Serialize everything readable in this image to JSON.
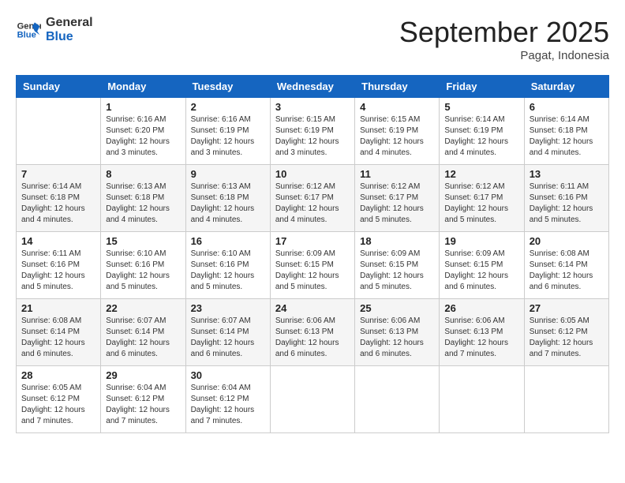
{
  "logo": {
    "line1": "General",
    "line2": "Blue"
  },
  "title": "September 2025",
  "location": "Pagat, Indonesia",
  "headers": [
    "Sunday",
    "Monday",
    "Tuesday",
    "Wednesday",
    "Thursday",
    "Friday",
    "Saturday"
  ],
  "weeks": [
    [
      {
        "day": "",
        "sunrise": "",
        "sunset": "",
        "daylight": ""
      },
      {
        "day": "1",
        "sunrise": "Sunrise: 6:16 AM",
        "sunset": "Sunset: 6:20 PM",
        "daylight": "Daylight: 12 hours and 3 minutes."
      },
      {
        "day": "2",
        "sunrise": "Sunrise: 6:16 AM",
        "sunset": "Sunset: 6:19 PM",
        "daylight": "Daylight: 12 hours and 3 minutes."
      },
      {
        "day": "3",
        "sunrise": "Sunrise: 6:15 AM",
        "sunset": "Sunset: 6:19 PM",
        "daylight": "Daylight: 12 hours and 3 minutes."
      },
      {
        "day": "4",
        "sunrise": "Sunrise: 6:15 AM",
        "sunset": "Sunset: 6:19 PM",
        "daylight": "Daylight: 12 hours and 4 minutes."
      },
      {
        "day": "5",
        "sunrise": "Sunrise: 6:14 AM",
        "sunset": "Sunset: 6:19 PM",
        "daylight": "Daylight: 12 hours and 4 minutes."
      },
      {
        "day": "6",
        "sunrise": "Sunrise: 6:14 AM",
        "sunset": "Sunset: 6:18 PM",
        "daylight": "Daylight: 12 hours and 4 minutes."
      }
    ],
    [
      {
        "day": "7",
        "sunrise": "Sunrise: 6:14 AM",
        "sunset": "Sunset: 6:18 PM",
        "daylight": "Daylight: 12 hours and 4 minutes."
      },
      {
        "day": "8",
        "sunrise": "Sunrise: 6:13 AM",
        "sunset": "Sunset: 6:18 PM",
        "daylight": "Daylight: 12 hours and 4 minutes."
      },
      {
        "day": "9",
        "sunrise": "Sunrise: 6:13 AM",
        "sunset": "Sunset: 6:18 PM",
        "daylight": "Daylight: 12 hours and 4 minutes."
      },
      {
        "day": "10",
        "sunrise": "Sunrise: 6:12 AM",
        "sunset": "Sunset: 6:17 PM",
        "daylight": "Daylight: 12 hours and 4 minutes."
      },
      {
        "day": "11",
        "sunrise": "Sunrise: 6:12 AM",
        "sunset": "Sunset: 6:17 PM",
        "daylight": "Daylight: 12 hours and 5 minutes."
      },
      {
        "day": "12",
        "sunrise": "Sunrise: 6:12 AM",
        "sunset": "Sunset: 6:17 PM",
        "daylight": "Daylight: 12 hours and 5 minutes."
      },
      {
        "day": "13",
        "sunrise": "Sunrise: 6:11 AM",
        "sunset": "Sunset: 6:16 PM",
        "daylight": "Daylight: 12 hours and 5 minutes."
      }
    ],
    [
      {
        "day": "14",
        "sunrise": "Sunrise: 6:11 AM",
        "sunset": "Sunset: 6:16 PM",
        "daylight": "Daylight: 12 hours and 5 minutes."
      },
      {
        "day": "15",
        "sunrise": "Sunrise: 6:10 AM",
        "sunset": "Sunset: 6:16 PM",
        "daylight": "Daylight: 12 hours and 5 minutes."
      },
      {
        "day": "16",
        "sunrise": "Sunrise: 6:10 AM",
        "sunset": "Sunset: 6:16 PM",
        "daylight": "Daylight: 12 hours and 5 minutes."
      },
      {
        "day": "17",
        "sunrise": "Sunrise: 6:09 AM",
        "sunset": "Sunset: 6:15 PM",
        "daylight": "Daylight: 12 hours and 5 minutes."
      },
      {
        "day": "18",
        "sunrise": "Sunrise: 6:09 AM",
        "sunset": "Sunset: 6:15 PM",
        "daylight": "Daylight: 12 hours and 5 minutes."
      },
      {
        "day": "19",
        "sunrise": "Sunrise: 6:09 AM",
        "sunset": "Sunset: 6:15 PM",
        "daylight": "Daylight: 12 hours and 6 minutes."
      },
      {
        "day": "20",
        "sunrise": "Sunrise: 6:08 AM",
        "sunset": "Sunset: 6:14 PM",
        "daylight": "Daylight: 12 hours and 6 minutes."
      }
    ],
    [
      {
        "day": "21",
        "sunrise": "Sunrise: 6:08 AM",
        "sunset": "Sunset: 6:14 PM",
        "daylight": "Daylight: 12 hours and 6 minutes."
      },
      {
        "day": "22",
        "sunrise": "Sunrise: 6:07 AM",
        "sunset": "Sunset: 6:14 PM",
        "daylight": "Daylight: 12 hours and 6 minutes."
      },
      {
        "day": "23",
        "sunrise": "Sunrise: 6:07 AM",
        "sunset": "Sunset: 6:14 PM",
        "daylight": "Daylight: 12 hours and 6 minutes."
      },
      {
        "day": "24",
        "sunrise": "Sunrise: 6:06 AM",
        "sunset": "Sunset: 6:13 PM",
        "daylight": "Daylight: 12 hours and 6 minutes."
      },
      {
        "day": "25",
        "sunrise": "Sunrise: 6:06 AM",
        "sunset": "Sunset: 6:13 PM",
        "daylight": "Daylight: 12 hours and 6 minutes."
      },
      {
        "day": "26",
        "sunrise": "Sunrise: 6:06 AM",
        "sunset": "Sunset: 6:13 PM",
        "daylight": "Daylight: 12 hours and 7 minutes."
      },
      {
        "day": "27",
        "sunrise": "Sunrise: 6:05 AM",
        "sunset": "Sunset: 6:12 PM",
        "daylight": "Daylight: 12 hours and 7 minutes."
      }
    ],
    [
      {
        "day": "28",
        "sunrise": "Sunrise: 6:05 AM",
        "sunset": "Sunset: 6:12 PM",
        "daylight": "Daylight: 12 hours and 7 minutes."
      },
      {
        "day": "29",
        "sunrise": "Sunrise: 6:04 AM",
        "sunset": "Sunset: 6:12 PM",
        "daylight": "Daylight: 12 hours and 7 minutes."
      },
      {
        "day": "30",
        "sunrise": "Sunrise: 6:04 AM",
        "sunset": "Sunset: 6:12 PM",
        "daylight": "Daylight: 12 hours and 7 minutes."
      },
      {
        "day": "",
        "sunrise": "",
        "sunset": "",
        "daylight": ""
      },
      {
        "day": "",
        "sunrise": "",
        "sunset": "",
        "daylight": ""
      },
      {
        "day": "",
        "sunrise": "",
        "sunset": "",
        "daylight": ""
      },
      {
        "day": "",
        "sunrise": "",
        "sunset": "",
        "daylight": ""
      }
    ]
  ]
}
